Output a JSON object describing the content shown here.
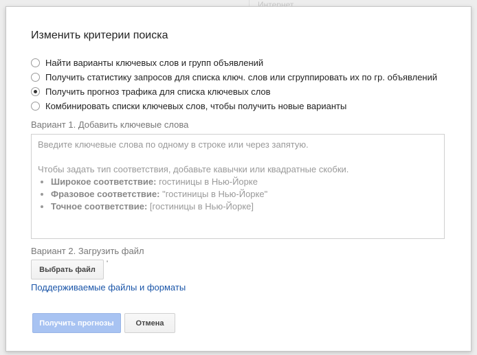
{
  "background": {
    "hint_text": "Интернет"
  },
  "dialog": {
    "title": "Изменить критерии поиска",
    "options": [
      {
        "label": "Найти варианты ключевых слов и групп объявлений",
        "checked": false
      },
      {
        "label": "Получить статистику запросов для списка ключ. слов или сгруппировать их по гр. объявлений",
        "checked": false
      },
      {
        "label": "Получить прогноз трафика для списка ключевых слов",
        "checked": true
      },
      {
        "label": "Комбинировать списки ключевых слов, чтобы получить новые варианты",
        "checked": false
      }
    ],
    "variant1_label": "Вариант 1. Добавить ключевые слова",
    "keywords_placeholder": {
      "line1": "Введите ключевые слова по одному в строке или через запятую.",
      "line2": "Чтобы задать тип соответствия, добавьте кавычки или квадратные скобки.",
      "broad_label": "Широкое соответствие:",
      "broad_example": "гостиницы в Нью-Йорке",
      "phrase_label": "Фразовое соответствие:",
      "phrase_example": "\"гостиницы в Нью-Йорке\"",
      "exact_label": "Точное соответствие:",
      "exact_example": "[гостиницы в Нью-Йорке]"
    },
    "variant2_label": "Вариант 2. Загрузить файл",
    "choose_file_label": "Выбрать файл",
    "file_status": "'",
    "supported_link": "Поддерживаемые файлы и форматы",
    "get_forecast_label": "Получить прогнозы",
    "cancel_label": "Отмена"
  },
  "colors": {
    "link": "#1a55a8",
    "primary_disabled": "#a8c3f2"
  }
}
